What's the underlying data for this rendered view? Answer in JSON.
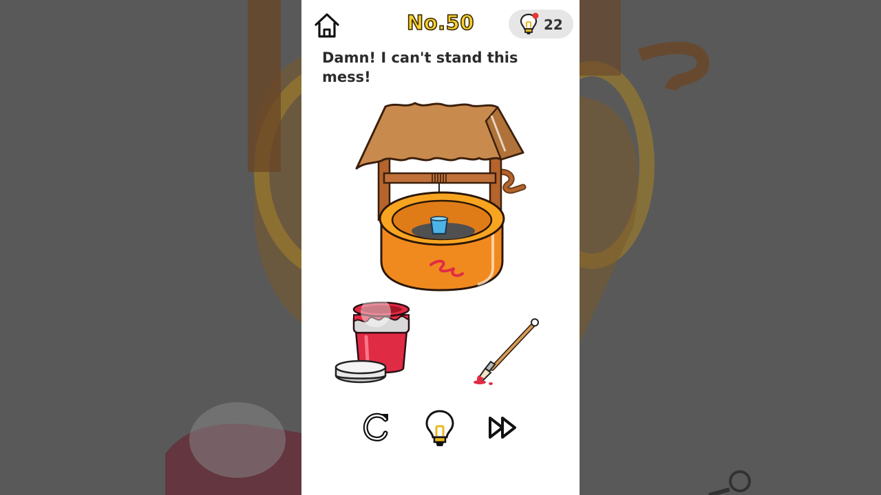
{
  "level": {
    "label": "No.50"
  },
  "hints": {
    "count": "22",
    "icon": "lightbulb-icon"
  },
  "prompt": {
    "text": "Damn! I can't stand this mess!"
  },
  "scene": {
    "main_object": "wishing-well",
    "items": [
      {
        "name": "paint-bucket",
        "color": "#e02b45"
      },
      {
        "name": "paint-brush"
      }
    ]
  },
  "controls": [
    {
      "name": "restart-button",
      "icon": "restart-icon"
    },
    {
      "name": "hint-button",
      "icon": "lightbulb-icon"
    },
    {
      "name": "skip-button",
      "icon": "fast-forward-icon"
    }
  ],
  "colors": {
    "title_fill": "#f5cf33",
    "backdrop": "#595959",
    "well_orange": "#f08a1f",
    "roof_brown": "#c98a4e",
    "paint_red": "#e02b45"
  }
}
